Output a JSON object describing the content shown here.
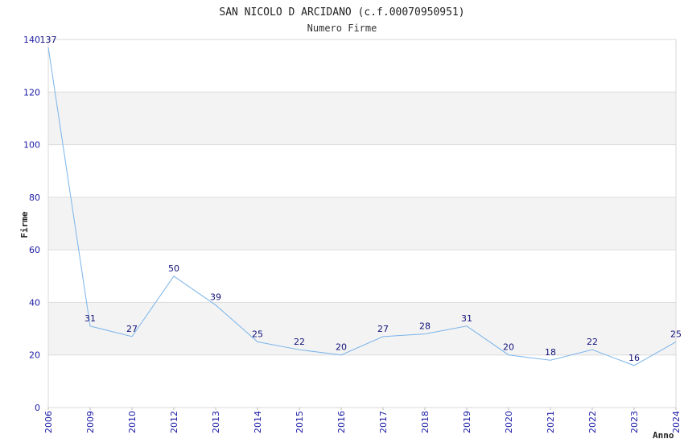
{
  "chart_data": {
    "type": "line",
    "title": "SAN NICOLO D ARCIDANO (c.f.00070950951)",
    "subtitle": "Numero Firme",
    "xlabel": "Anno",
    "ylabel": "Firme",
    "categories": [
      "2006",
      "2009",
      "2010",
      "2012",
      "2013",
      "2014",
      "2015",
      "2016",
      "2017",
      "2018",
      "2019",
      "2020",
      "2021",
      "2022",
      "2023",
      "2024"
    ],
    "series": [
      {
        "values": [
          137,
          31,
          27,
          50,
          39,
          25,
          22,
          20,
          27,
          28,
          31,
          20,
          18,
          22,
          16,
          25
        ]
      }
    ],
    "ylim": [
      0,
      140
    ],
    "yticks": [
      0,
      20,
      40,
      60,
      80,
      100,
      120,
      140
    ],
    "grid": "horizontal bands",
    "line_color": "#7ab4ea",
    "band_color": "#f3f3f3",
    "tick_color": "#1a1aa6",
    "label_color": "#10107a"
  }
}
